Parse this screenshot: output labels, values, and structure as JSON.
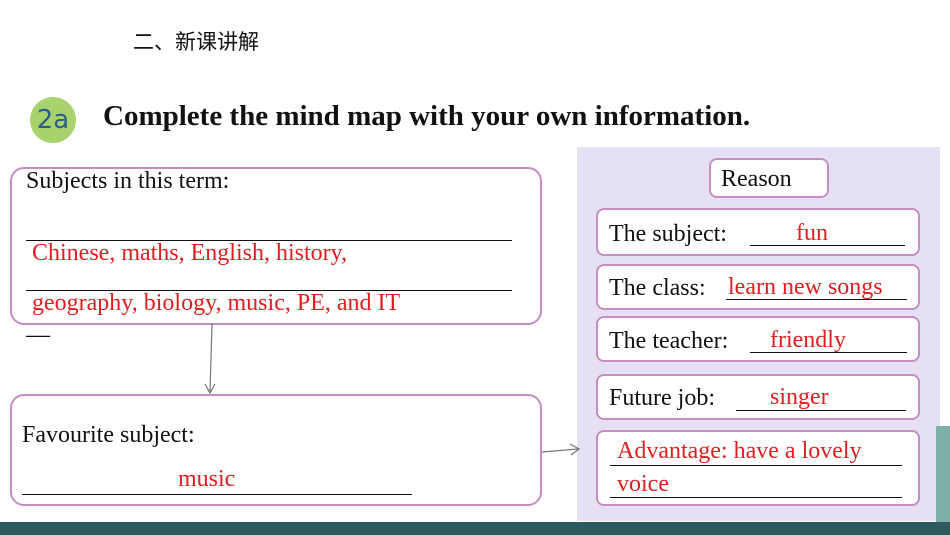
{
  "section_title": "二、新课讲解",
  "badge": "2a",
  "heading": "Complete the mind map with your own information.",
  "subjects": {
    "label": "Subjects in this term:",
    "line1_answer": "Chinese, maths, English, history,",
    "line2_answer": "geography, biology, music, PE,  and IT",
    "trailing_dash": "—"
  },
  "favourite": {
    "label": "Favourite subject:",
    "answer": "music"
  },
  "reasons": {
    "title": "Reason",
    "items": [
      {
        "label": "The subject:",
        "answer": "fun"
      },
      {
        "label": "The class:",
        "answer": "learn new songs"
      },
      {
        "label": "The teacher:",
        "answer": "friendly"
      },
      {
        "label": "Future job:",
        "answer": "singer"
      }
    ],
    "advantage_line1": "Advantage: have a lovely",
    "advantage_line2": "voice"
  },
  "colors": {
    "accent_border": "#c58fc4",
    "answer_red": "#e02020",
    "panel_bg": "#e6e0f5",
    "badge_bg": "#a8d26c"
  }
}
